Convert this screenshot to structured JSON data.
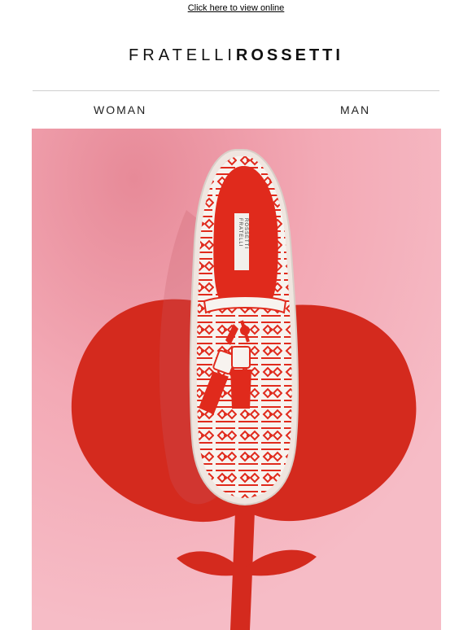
{
  "preheader": {
    "view_online_label": "Click here to view online"
  },
  "header": {
    "logo_light": "FRATELLI",
    "logo_bold": "ROSSETTI"
  },
  "nav": {
    "woman_label": "WOMAN",
    "man_label": "MAN"
  },
  "hero": {
    "insole_brand_line1": "FRATELLI",
    "insole_brand_line2": "ROSSETTI",
    "colors": {
      "background": "#f2a3b0",
      "flower": "#d42a1e",
      "shoe_red": "#e02a1c",
      "shoe_white": "#f7f3ef"
    }
  }
}
